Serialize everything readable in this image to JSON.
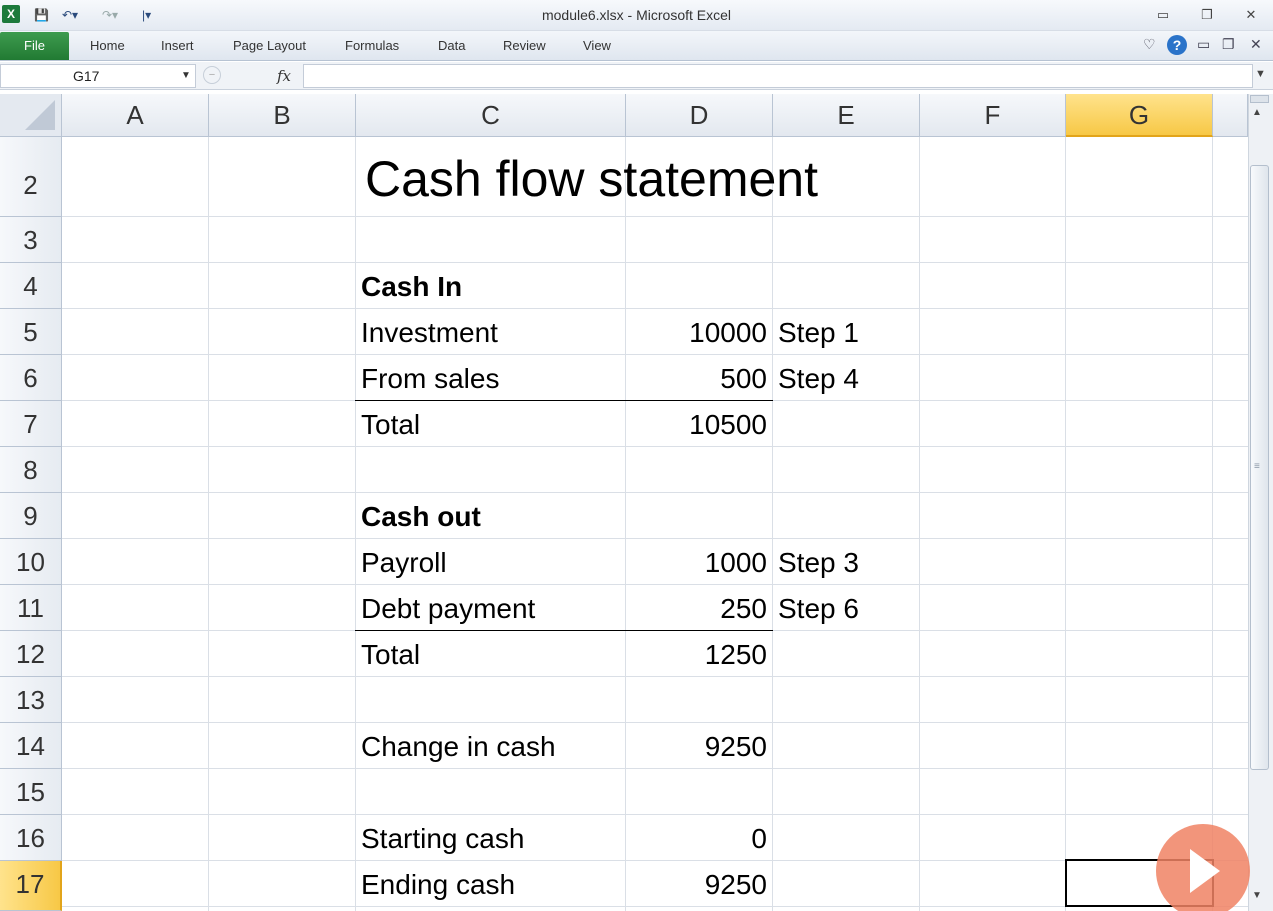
{
  "window": {
    "title": "module6.xlsx - Microsoft Excel",
    "app_icon": "X"
  },
  "ribbon": {
    "file_label": "File",
    "tabs": [
      "Home",
      "Insert",
      "Page Layout",
      "Formulas",
      "Data",
      "Review",
      "View"
    ]
  },
  "formula_bar": {
    "name_box": "G17",
    "fx_label": "fx",
    "formula": ""
  },
  "sheet": {
    "columns": [
      "A",
      "B",
      "C",
      "D",
      "E",
      "F",
      "G"
    ],
    "selected_column": "G",
    "rows": [
      "2",
      "3",
      "4",
      "5",
      "6",
      "7",
      "8",
      "9",
      "10",
      "11",
      "12",
      "13",
      "14",
      "15",
      "16",
      "17"
    ],
    "selected_row": "17",
    "title": "Cash flow statement",
    "cash_in_header": "Cash In",
    "investment_label": "Investment",
    "investment_value": "10000",
    "investment_note": "Step 1",
    "sales_label": "From sales",
    "sales_value": "500",
    "sales_note": "Step 4",
    "cash_in_total_label": "Total",
    "cash_in_total_value": "10500",
    "cash_out_header": "Cash out",
    "payroll_label": "Payroll",
    "payroll_value": "1000",
    "payroll_note": "Step 3",
    "debt_label": "Debt payment",
    "debt_value": "250",
    "debt_note": "Step 6",
    "cash_out_total_label": "Total",
    "cash_out_total_value": "1250",
    "change_label": "Change in cash",
    "change_value": "9250",
    "starting_label": "Starting cash",
    "starting_value": "0",
    "ending_label": "Ending cash",
    "ending_value": "9250"
  },
  "colors": {
    "file_tab": "#217a33",
    "selected_header": "#f7c846",
    "help": "#2a73c9"
  }
}
